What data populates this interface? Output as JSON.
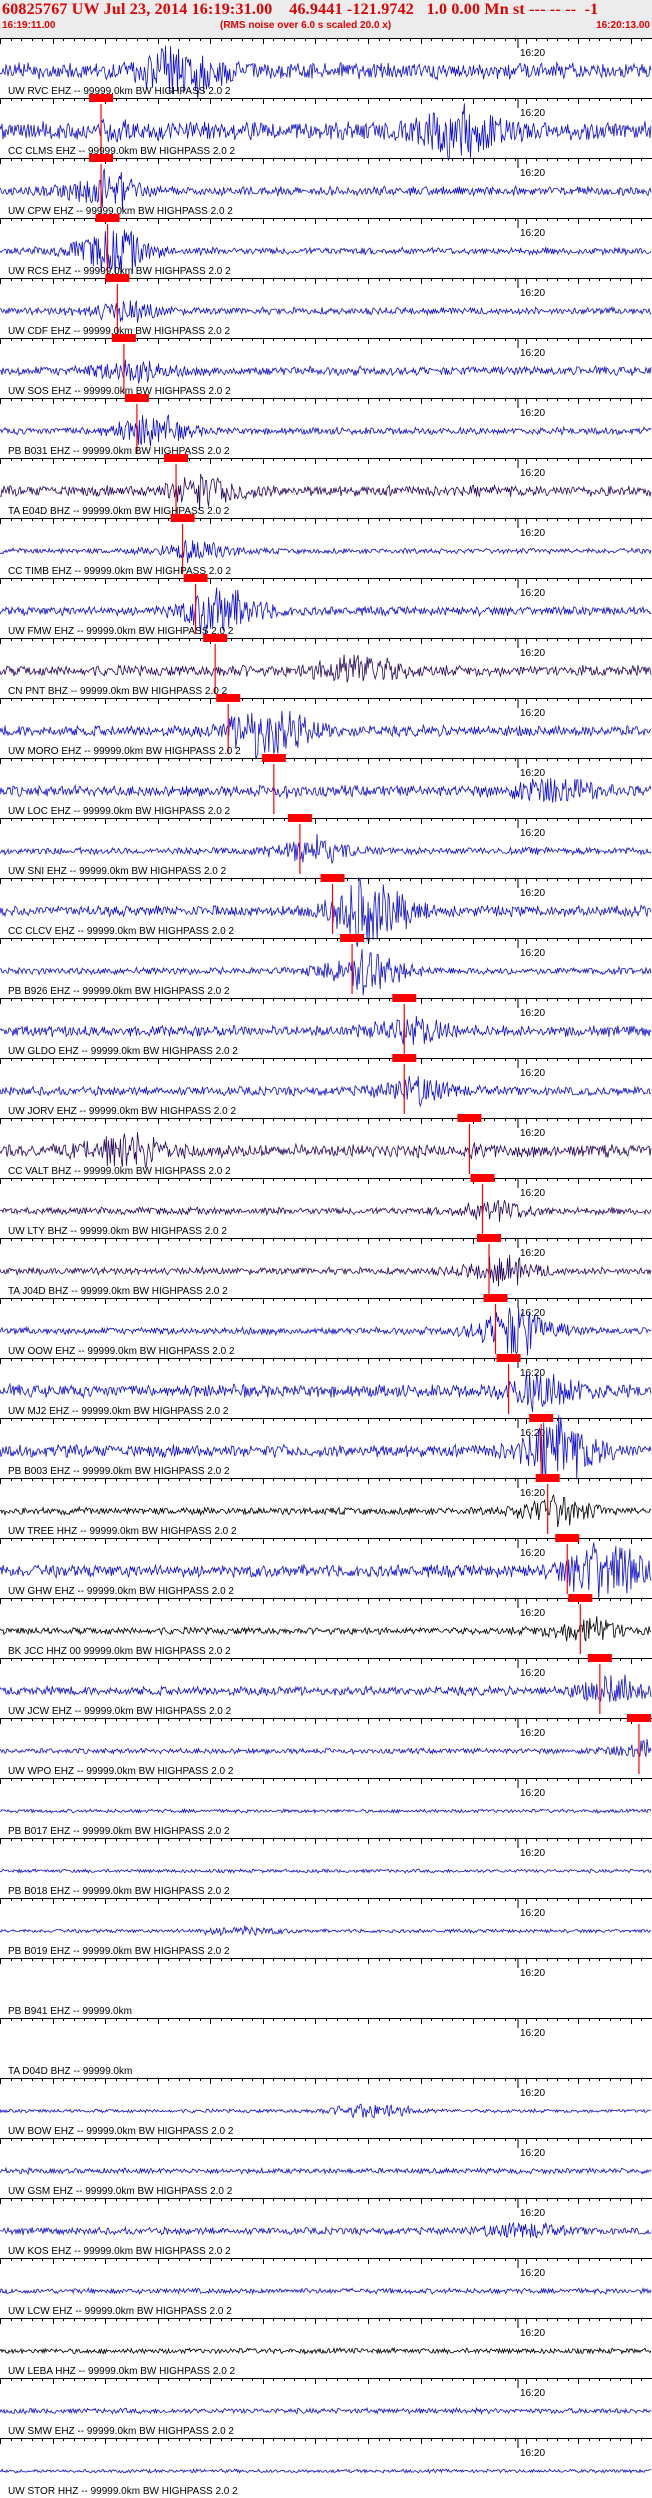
{
  "header": {
    "title": "60825767 UW Jul 23, 2014 16:19:31.00    46.9441 -121.9742   1.0 0.00 Mn st --- -- --  -1",
    "start_time": "16:19:11.00",
    "note": "(RMS noise over 6.0 s scaled 20.0 x)",
    "end_time": "16:20:13.00"
  },
  "colors": {
    "header_text": "#e00000",
    "trace_blue": "#1010d0",
    "trace_dark": "#2a0a5e",
    "trace_black": "#000000",
    "pick": "#ff0000"
  },
  "chart_data": {
    "type": "line",
    "title": "60825767 UW Jul 23, 2014 16:19:31.00",
    "x_range": [
      "16:19:11.00",
      "16:20:13.00"
    ],
    "x_tick_label": "16:20",
    "rows": [
      {
        "label": "UW RVC EHZ -- 99999.0km BW  HIGHPASS  2.0  2",
        "pick": null,
        "amp": 9,
        "burst_at": 0.28,
        "burst_amp": 26,
        "color": "blue"
      },
      {
        "label": "CC CLMS EHZ -- 99999.0km BW  HIGHPASS  2.0  2",
        "pick": 0.155,
        "amp": 10,
        "burst_at": 0.7,
        "burst_amp": 26,
        "color": "blue"
      },
      {
        "label": "UW CPW EHZ -- 99999.0km BW  HIGHPASS  2.0  2",
        "pick": 0.155,
        "amp": 5,
        "burst_at": 0.16,
        "burst_amp": 14,
        "color": "blue"
      },
      {
        "label": "UW RCS EHZ -- 99999.0km BW  HIGHPASS  2.0  2",
        "pick": 0.165,
        "amp": 4,
        "burst_at": 0.17,
        "burst_amp": 20,
        "color": "blue"
      },
      {
        "label": "UW CDF EHZ -- 99999.0km BW  HIGHPASS  2.0  2",
        "pick": 0.18,
        "amp": 4,
        "burst_at": 0.19,
        "burst_amp": 8,
        "color": "blue"
      },
      {
        "label": "UW SOS EHZ -- 99999.0km BW  HIGHPASS  2.0  2",
        "pick": 0.19,
        "amp": 5,
        "burst_at": 0.2,
        "burst_amp": 8,
        "color": "blue"
      },
      {
        "label": "PB B031 EHZ -- 99999.0km BW  HIGHPASS  2.0  2",
        "pick": 0.21,
        "amp": 4,
        "burst_at": 0.23,
        "burst_amp": 12,
        "color": "blue"
      },
      {
        "label": "TA E04D BHZ -- 99999.0km BW  HIGHPASS  2.0  2",
        "pick": 0.27,
        "amp": 6,
        "burst_at": 0.32,
        "burst_amp": 12,
        "color": "dark"
      },
      {
        "label": "CC TIMB EHZ -- 99999.0km BW  HIGHPASS  2.0  2",
        "pick": 0.28,
        "amp": 3,
        "burst_at": 0.3,
        "burst_amp": 8,
        "color": "blue"
      },
      {
        "label": "UW FMW EHZ -- 99999.0km BW  HIGHPASS  2.0  2",
        "pick": 0.3,
        "amp": 5,
        "burst_at": 0.34,
        "burst_amp": 22,
        "color": "blue"
      },
      {
        "label": "CN PNT BHZ -- 99999.0km BW  HIGHPASS  2.0  2",
        "pick": 0.33,
        "amp": 6,
        "burst_at": 0.55,
        "burst_amp": 16,
        "color": "dark"
      },
      {
        "label": "UW MORO EHZ -- 99999.0km BW  HIGHPASS  2.0  2",
        "pick": 0.35,
        "amp": 6,
        "burst_at": 0.42,
        "burst_amp": 24,
        "color": "blue"
      },
      {
        "label": "UW LOC EHZ -- 99999.0km BW  HIGHPASS  2.0  2",
        "pick": 0.42,
        "amp": 6,
        "burst_at": 0.85,
        "burst_amp": 14,
        "color": "blue"
      },
      {
        "label": "UW SNI EHZ -- 99999.0km BW  HIGHPASS  2.0  2",
        "pick": 0.46,
        "amp": 4,
        "burst_at": 0.48,
        "burst_amp": 10,
        "color": "blue"
      },
      {
        "label": "CC CLCV EHZ -- 99999.0km BW  HIGHPASS  2.0  2",
        "pick": 0.51,
        "amp": 6,
        "burst_at": 0.57,
        "burst_amp": 30,
        "color": "blue"
      },
      {
        "label": "PB B926 EHZ -- 99999.0km BW  HIGHPASS  2.0  2",
        "pick": 0.54,
        "amp": 4,
        "burst_at": 0.56,
        "burst_amp": 18,
        "color": "blue"
      },
      {
        "label": "UW GLDO EHZ -- 99999.0km BW  HIGHPASS  2.0  2",
        "pick": 0.62,
        "amp": 6,
        "burst_at": 0.63,
        "burst_amp": 10,
        "color": "blue"
      },
      {
        "label": "UW JORV EHZ -- 99999.0km BW  HIGHPASS  2.0  2",
        "pick": 0.62,
        "amp": 5,
        "burst_at": 0.64,
        "burst_amp": 10,
        "color": "blue"
      },
      {
        "label": "CC VALT BHZ -- 99999.0km BW  HIGHPASS  2.0  2",
        "pick": 0.72,
        "amp": 7,
        "burst_at": 0.2,
        "burst_amp": 18,
        "color": "dark"
      },
      {
        "label": "UW LTY BHZ -- 99999.0km BW  HIGHPASS  2.0  2",
        "pick": 0.74,
        "amp": 4,
        "burst_at": 0.76,
        "burst_amp": 8,
        "color": "dark"
      },
      {
        "label": "TA J04D BHZ -- 99999.0km BW  HIGHPASS  2.0  2",
        "pick": 0.75,
        "amp": 4,
        "burst_at": 0.77,
        "burst_amp": 10,
        "color": "dark"
      },
      {
        "label": "UW OOW EHZ -- 99999.0km BW  HIGHPASS  2.0  2",
        "pick": 0.76,
        "amp": 4,
        "burst_at": 0.79,
        "burst_amp": 22,
        "color": "blue"
      },
      {
        "label": "UW MJ2 EHZ -- 99999.0km BW  HIGHPASS  2.0  2",
        "pick": 0.78,
        "amp": 7,
        "burst_at": 0.84,
        "burst_amp": 14,
        "color": "blue"
      },
      {
        "label": "PB B003 EHZ -- 99999.0km BW  HIGHPASS  2.0  2",
        "pick": 0.83,
        "amp": 7,
        "burst_at": 0.86,
        "burst_amp": 26,
        "color": "blue"
      },
      {
        "label": "UW TREE HHZ -- 99999.0km BW  HIGHPASS  2.0  2",
        "pick": 0.84,
        "amp": 4,
        "burst_at": 0.85,
        "burst_amp": 12,
        "color": "black"
      },
      {
        "label": "UW GHW EHZ -- 99999.0km BW  HIGHPASS  2.0  2",
        "pick": 0.87,
        "amp": 7,
        "burst_at": 0.93,
        "burst_amp": 24,
        "color": "blue"
      },
      {
        "label": "BK JCC HHZ 00 99999.0km BW  HIGHPASS  2.0  2",
        "pick": 0.89,
        "amp": 4,
        "burst_at": 0.9,
        "burst_amp": 10,
        "color": "black"
      },
      {
        "label": "UW JCW EHZ -- 99999.0km BW  HIGHPASS  2.0  2",
        "pick": 0.92,
        "amp": 5,
        "burst_at": 0.94,
        "burst_amp": 10,
        "color": "blue"
      },
      {
        "label": "UW WPO EHZ -- 99999.0km BW  HIGHPASS  2.0  2",
        "pick": 0.98,
        "amp": 3,
        "burst_at": 0.99,
        "burst_amp": 8,
        "color": "blue"
      },
      {
        "label": "PB B017 EHZ -- 99999.0km BW  HIGHPASS  2.0  2",
        "pick": null,
        "amp": 2,
        "burst_at": null,
        "burst_amp": 0,
        "color": "blue"
      },
      {
        "label": "PB B018 EHZ -- 99999.0km BW  HIGHPASS  2.0  2",
        "pick": null,
        "amp": 2,
        "burst_at": null,
        "burst_amp": 0,
        "color": "blue"
      },
      {
        "label": "PB B019 EHZ -- 99999.0km BW  HIGHPASS  2.0  2",
        "pick": null,
        "amp": 2,
        "burst_at": 0.37,
        "burst_amp": 4,
        "color": "blue"
      },
      {
        "label": "PB B941 EHZ -- 99999.0km",
        "pick": null,
        "amp": 0,
        "burst_at": null,
        "burst_amp": 0,
        "color": "blue"
      },
      {
        "label": "TA D04D BHZ -- 99999.0km",
        "pick": null,
        "amp": 0,
        "burst_at": null,
        "burst_amp": 0,
        "color": "blue"
      },
      {
        "label": "UW BOW EHZ -- 99999.0km BW  HIGHPASS  2.0  2",
        "pick": null,
        "amp": 2,
        "burst_at": 0.57,
        "burst_amp": 8,
        "color": "blue"
      },
      {
        "label": "UW GSM EHZ -- 99999.0km BW  HIGHPASS  2.0  2",
        "pick": null,
        "amp": 3,
        "burst_at": null,
        "burst_amp": 0,
        "color": "blue"
      },
      {
        "label": "UW KOS EHZ -- 99999.0km BW  HIGHPASS  2.0  2",
        "pick": null,
        "amp": 4,
        "burst_at": 0.8,
        "burst_amp": 7,
        "color": "blue"
      },
      {
        "label": "UW LCW EHZ -- 99999.0km BW  HIGHPASS  2.0  2",
        "pick": null,
        "amp": 3,
        "burst_at": null,
        "burst_amp": 0,
        "color": "blue"
      },
      {
        "label": "UW LEBA HHZ -- 99999.0km BW  HIGHPASS  2.0  2",
        "pick": null,
        "amp": 3,
        "burst_at": null,
        "burst_amp": 0,
        "color": "black"
      },
      {
        "label": "UW SMW EHZ -- 99999.0km BW  HIGHPASS  2.0  2",
        "pick": null,
        "amp": 3,
        "burst_at": null,
        "burst_amp": 0,
        "color": "blue"
      },
      {
        "label": "UW STOR HHZ -- 99999.0km BW  HIGHPASS  2.0  2",
        "pick": null,
        "amp": 2,
        "burst_at": null,
        "burst_amp": 0,
        "color": "blue"
      }
    ]
  }
}
